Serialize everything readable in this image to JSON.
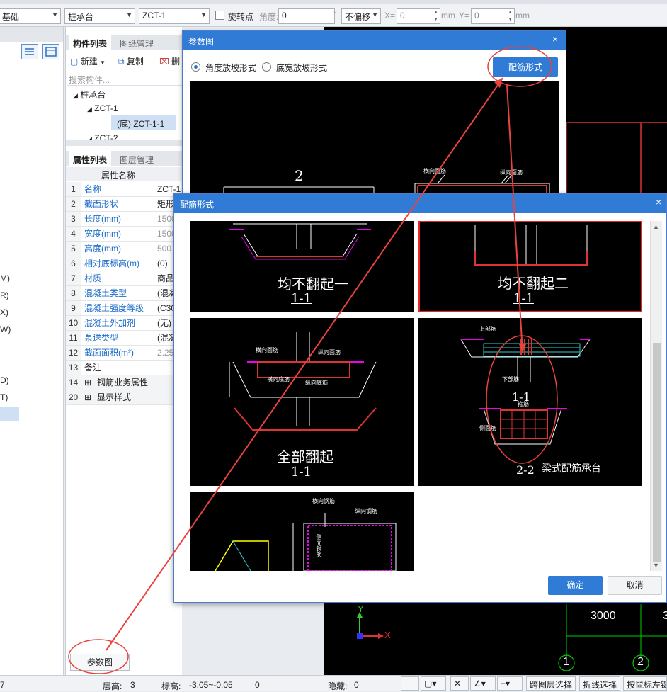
{
  "toolbar": {
    "category": "基础",
    "component_type": "桩承台",
    "component_name": "ZCT-1",
    "rotate_label": "旋转点",
    "angle_label": "角度:",
    "angle_value": "0",
    "degree_unit": "°",
    "offset_value": "不偏移",
    "x_label": "X=",
    "x_value": "0",
    "mm1": "mm",
    "y_label": "Y=",
    "y_value": "0",
    "mm2": "mm"
  },
  "left_panel": {
    "items": [
      "M)",
      "R)",
      "X)",
      "W)",
      "D)",
      "T)"
    ]
  },
  "component_panel": {
    "tab_list": "构件列表",
    "tab_drawings": "图纸管理",
    "new_label": "新建",
    "copy_label": "复制",
    "delete_label": "删",
    "search_placeholder": "搜索构件...",
    "tree": {
      "root": "桩承台",
      "child1": "ZCT-1",
      "child1_sub": "(底) ZCT-1-1",
      "child2": "ZCT-2"
    }
  },
  "property_panel": {
    "tab_props": "属性列表",
    "tab_layers": "图层管理",
    "col_name": "属性名称",
    "rows": [
      {
        "num": "1",
        "name": "名称",
        "value": "ZCT-1"
      },
      {
        "num": "2",
        "name": "截面形状",
        "value": "矩形"
      },
      {
        "num": "3",
        "name": "长度(mm)",
        "value": "1500"
      },
      {
        "num": "4",
        "name": "宽度(mm)",
        "value": "1500"
      },
      {
        "num": "5",
        "name": "高度(mm)",
        "value": "500"
      },
      {
        "num": "6",
        "name": "相对底标高(m)",
        "value": "(0)"
      },
      {
        "num": "7",
        "name": "材质",
        "value": "商品"
      },
      {
        "num": "8",
        "name": "混凝土类型",
        "value": "(混凝"
      },
      {
        "num": "9",
        "name": "混凝土强度等级",
        "value": "(C30"
      },
      {
        "num": "10",
        "name": "混凝土外加剂",
        "value": "(无)"
      },
      {
        "num": "11",
        "name": "泵送类型",
        "value": "(混凝"
      },
      {
        "num": "12",
        "name": "截面面积(m²)",
        "value": "2.25"
      },
      {
        "num": "13",
        "name": "备注",
        "value": ""
      },
      {
        "num": "14",
        "name": "钢筋业务属性",
        "value": ""
      },
      {
        "num": "20",
        "name": "显示样式",
        "value": ""
      }
    ],
    "param_button": "参数图"
  },
  "dialog_params": {
    "title": "参数图",
    "close": "×",
    "radio_angle": "角度放坡形式",
    "radio_width": "底宽放坡形式",
    "rebar_button": "配筋形式",
    "preview_number": "2",
    "label_transverse": "横向面筋",
    "label_longitudinal": "纵向面筋"
  },
  "dialog_rebar": {
    "title": "配筋形式",
    "close": "×",
    "options": [
      {
        "title": "均不翻起一",
        "section": "1-1"
      },
      {
        "title": "均不翻起二",
        "section": "1-1"
      },
      {
        "title": "全部翻起",
        "section": "1-1"
      },
      {
        "title": "梁式配筋承台",
        "section": "2-2",
        "section2": "1-1"
      },
      {
        "title": "",
        "section": ""
      }
    ],
    "cad_labels": {
      "transverse_top": "横向面筋",
      "longitudinal_top": "纵向面筋",
      "transverse_bottom": "横向底筋",
      "longitudinal_bottom": "纵向底筋",
      "top_bar": "上部筋",
      "bottom_bar": "下部筋",
      "stirrup": "箍筋",
      "side_bar": "侧面筋",
      "transverse_rebar": "横向钢筋",
      "longitudinal_rebar": "纵向钢筋",
      "side_rebar": "侧面钢筋"
    },
    "ok_button": "确定",
    "cancel_button": "取消"
  },
  "cad_canvas": {
    "dimension": "3000",
    "dimension2": "3",
    "axis1": "1",
    "axis2": "2",
    "x_axis": "X",
    "y_axis": "Y"
  },
  "status_bar": {
    "left_value": "7",
    "floor_label": "层高:",
    "floor_value": "3",
    "elev_label": "标高:",
    "elev_value": "-3.05~-0.05",
    "zero": "0",
    "hidden_label": "隐藏:",
    "hidden_value": "0",
    "cross_layer": "跨图层选择",
    "polyline": "折线选择",
    "mouse_left": "按鼠标左键"
  },
  "colors": {
    "accent": "#2f7bd6",
    "annotation": "#e8433e",
    "cad_bg": "#000000"
  }
}
